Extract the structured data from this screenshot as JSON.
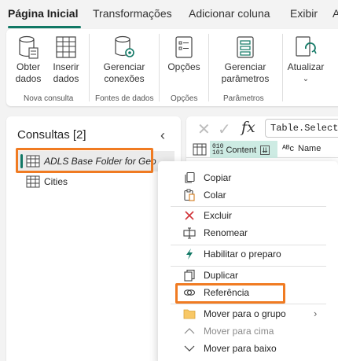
{
  "ribbon_tabs": [
    "Página Inicial",
    "Transformações",
    "Adicionar coluna",
    "Exibir",
    "A"
  ],
  "ribbon": {
    "buttons": {
      "obter_dados": "Obter dados",
      "inserir_dados": "Inserir dados",
      "gerenciar_conexoes": "Gerenciar conexões",
      "opcoes": "Opções",
      "gerenciar_parametros": "Gerenciar parâmetros",
      "atualizar": "Atualizar"
    },
    "groups": {
      "nova_consulta": "Nova consulta",
      "fontes_de_dados": "Fontes de dados",
      "opcoes": "Opções",
      "parametros": "Parâmetros"
    }
  },
  "queries": {
    "title": "Consultas [2]",
    "items": [
      {
        "label": "ADLS Base Folder for Geo",
        "selected": true
      },
      {
        "label": "Cities",
        "selected": false
      }
    ]
  },
  "formula_bar": {
    "fx": "fx",
    "text": "Table.SelectR"
  },
  "grid": {
    "type_icon": "010\n101",
    "columns": [
      "Content",
      "Name"
    ]
  },
  "context_menu": {
    "items": [
      {
        "label": "Copiar",
        "icon": "copy-icon",
        "disabled": false
      },
      {
        "label": "Colar",
        "icon": "paste-icon",
        "disabled": false
      },
      {
        "label": "Excluir",
        "icon": "delete-icon",
        "disabled": false
      },
      {
        "label": "Renomear",
        "icon": "rename-icon",
        "disabled": false
      },
      {
        "label": "Habilitar o preparo",
        "icon": "lightning-icon",
        "disabled": false
      },
      {
        "label": "Duplicar",
        "icon": "duplicate-icon",
        "disabled": false
      },
      {
        "label": "Referência",
        "icon": "reference-icon",
        "disabled": false
      },
      {
        "label": "Mover para o grupo",
        "icon": "folder-icon",
        "disabled": false
      },
      {
        "label": "Mover para cima",
        "icon": "chevron-up-icon",
        "disabled": true
      },
      {
        "label": "Mover para baixo",
        "icon": "chevron-down-icon",
        "disabled": false
      }
    ]
  },
  "colors": {
    "accent": "#117865",
    "highlight": "#f07b22",
    "delete_red": "#d13438",
    "lightning_green": "#117865"
  }
}
